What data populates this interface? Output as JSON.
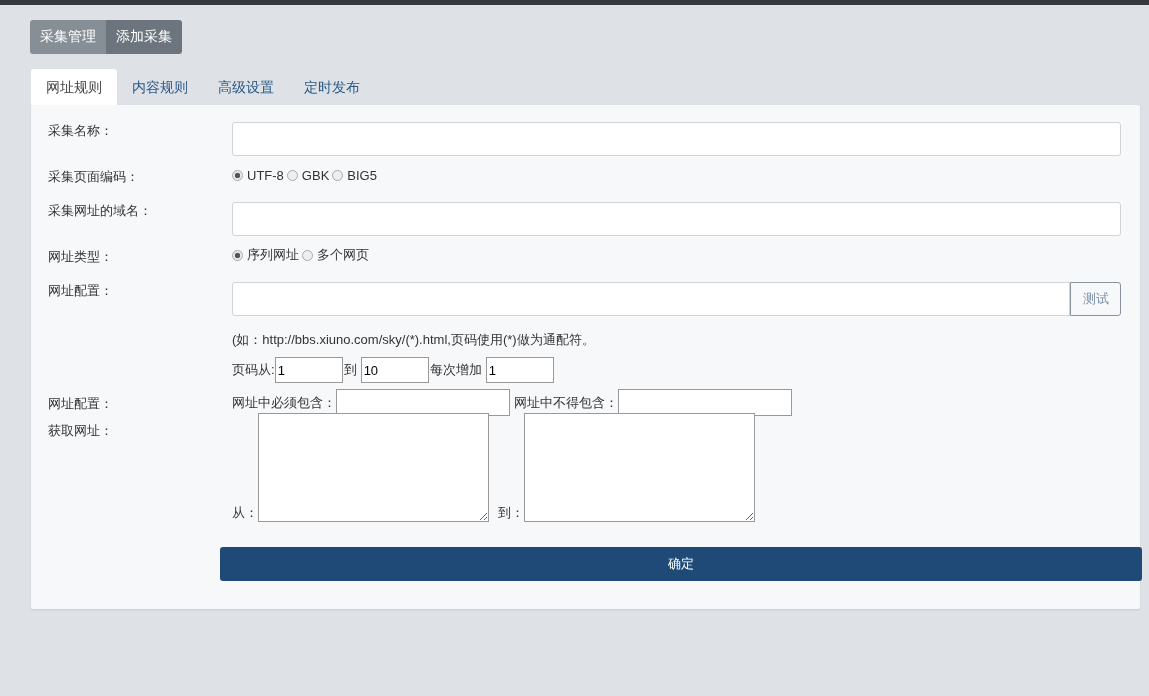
{
  "top_buttons": [
    {
      "label": "采集管理",
      "selected": false
    },
    {
      "label": "添加采集",
      "selected": true
    }
  ],
  "tabs": [
    {
      "label": "网址规则",
      "selected": true
    },
    {
      "label": "内容规则",
      "selected": false
    },
    {
      "label": "高级设置",
      "selected": false
    },
    {
      "label": "定时发布",
      "selected": false
    }
  ],
  "rows": [
    {
      "kind": "text",
      "label": "采集名称："
    },
    {
      "kind": "radio",
      "label": "采集页面编码：",
      "options": [
        {
          "label": "UTF-8",
          "selected": true
        },
        {
          "label": "GBK",
          "selected": false
        },
        {
          "label": "BIG5",
          "selected": false
        }
      ]
    },
    {
      "kind": "text",
      "label": "采集网址的域名："
    },
    {
      "kind": "radio",
      "label": "网址类型：",
      "options": [
        {
          "label": "序列网址",
          "selected": true
        },
        {
          "label": "多个网页",
          "selected": false
        }
      ]
    },
    {
      "kind": "url",
      "label": "网址配置：",
      "button": "测试",
      "hint": "(如：http://bbs.xiuno.com/sky/(*).html,页码使用(*)做为通配符。",
      "page_from_label": "页码从:",
      "page_from": "1",
      "page_to_label": "到",
      "page_to": "10",
      "step_label": "每次增加",
      "step": "1"
    },
    {
      "kind": "filter",
      "label": "网址配置：",
      "include_label": "网址中必须包含：",
      "exclude_label": "网址中不得包含："
    },
    {
      "kind": "range",
      "label": "获取网址：",
      "from_label": "从：",
      "to_label": "到："
    }
  ],
  "submit": "确定"
}
